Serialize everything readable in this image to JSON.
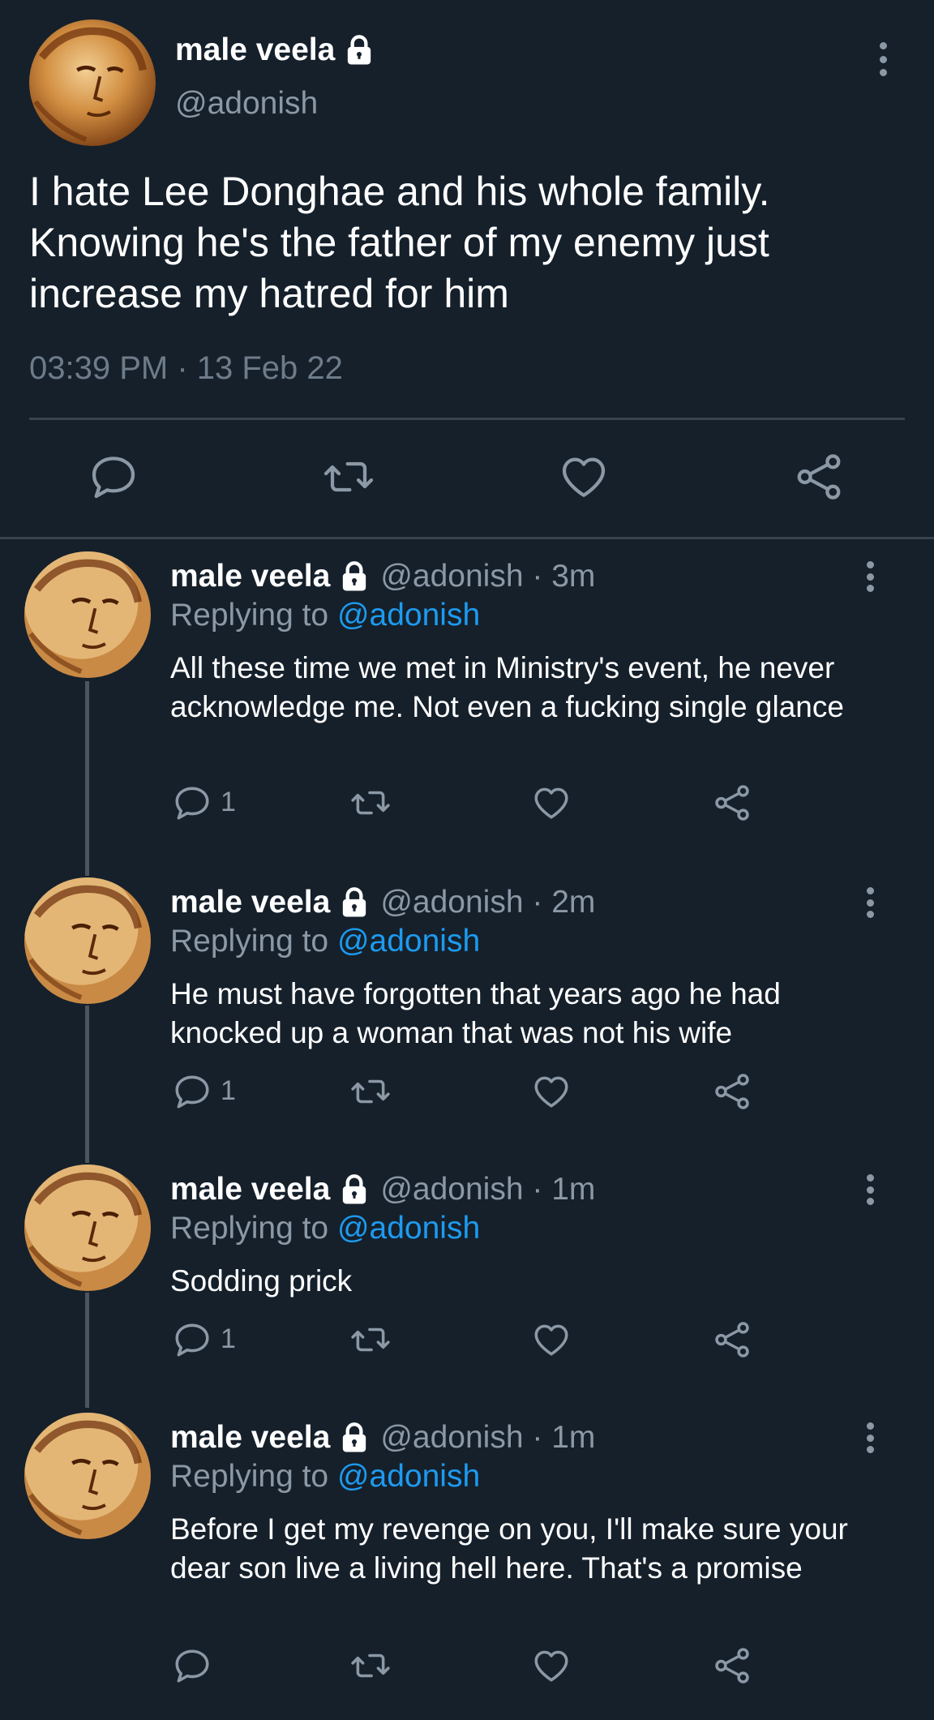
{
  "tweet": {
    "author_name": "male veela",
    "handle": "@adonish",
    "text": "I hate Lee Donghae and his whole family. Knowing he's the father of my enemy just increase my hatred for him",
    "timestamp": "03:39 PM · 13 Feb 22"
  },
  "replies": [
    {
      "author_name": "male veela",
      "handle": "@adonish · 3m",
      "replying_prefix": "Replying to ",
      "replying_to": "@adonish",
      "text": "All these time we met in Ministry's event, he never acknowledge me. Not even a fucking single glance",
      "reply_count": "1"
    },
    {
      "author_name": "male veela",
      "handle": "@adonish · 2m",
      "replying_prefix": "Replying to ",
      "replying_to": "@adonish",
      "text": "He must have forgotten that years ago he had knocked up a woman that was not his wife",
      "reply_count": "1"
    },
    {
      "author_name": "male veela",
      "handle": "@adonish · 1m",
      "replying_prefix": "Replying to ",
      "replying_to": "@adonish",
      "text": "Sodding prick",
      "reply_count": "1"
    },
    {
      "author_name": "male veela",
      "handle": "@adonish · 1m",
      "replying_prefix": "Replying to ",
      "replying_to": "@adonish",
      "text": "Before I get my revenge on you, I'll make sure your dear son live a living hell here. That's a promise",
      "reply_count": ""
    }
  ],
  "icons": {
    "protected": "lock-icon",
    "reply": "comment-icon",
    "retweet": "retweet-icon",
    "like": "heart-icon",
    "share": "share-icon",
    "more": "more-vertical-icon"
  },
  "colors": {
    "background": "#15202b",
    "text": "#ffffff",
    "secondary_text": "#8b98a5",
    "mention": "#1d9bf0",
    "divider": "#38444d"
  }
}
